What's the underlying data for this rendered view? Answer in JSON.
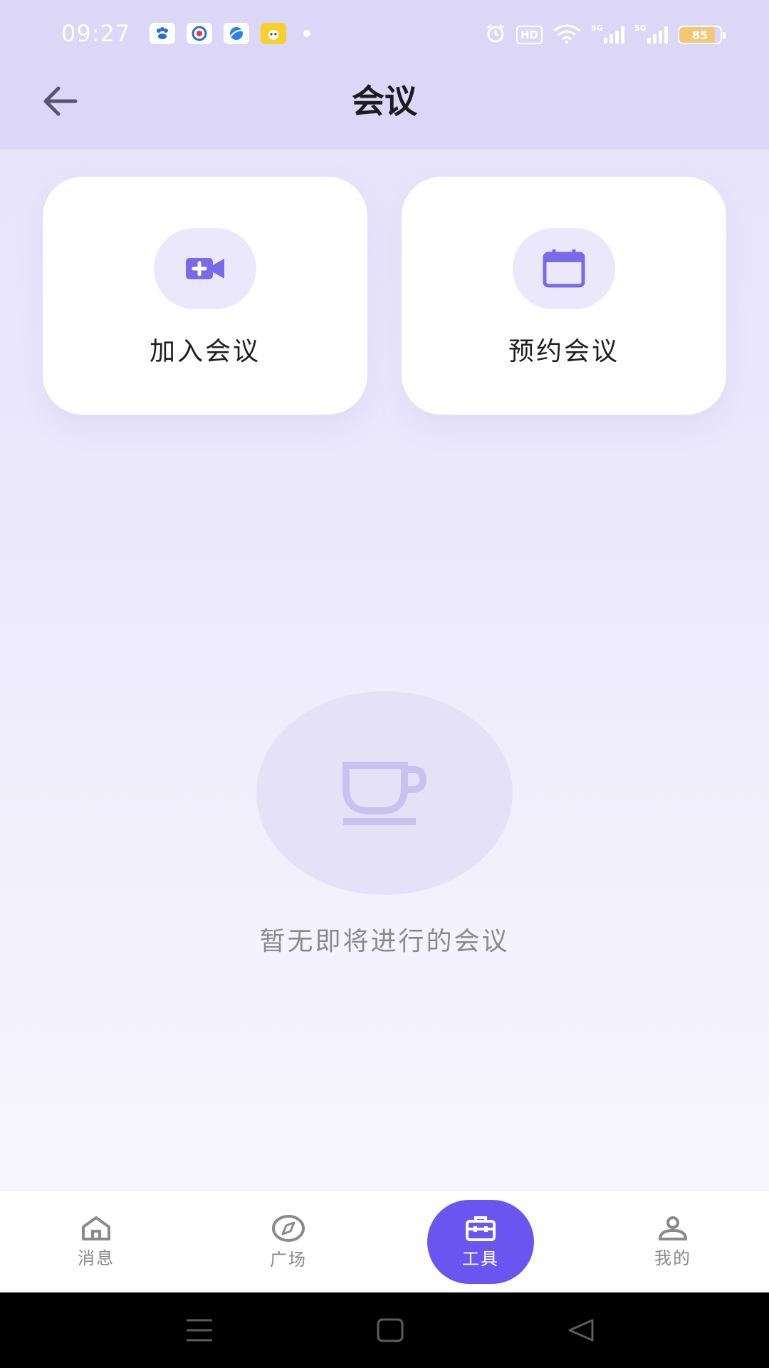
{
  "status_bar": {
    "time": "09:27",
    "hd_label": "HD",
    "network_1": "5G",
    "network_2": "5G",
    "battery": "85",
    "notification_apps": [
      "baidu-app-icon",
      "tencent-news-icon",
      "browser-icon",
      "game-icon"
    ]
  },
  "header": {
    "title": "会议",
    "back_icon": "arrow-left-icon"
  },
  "actions": [
    {
      "label": "加入会议",
      "icon": "video-plus-icon"
    },
    {
      "label": "预约会议",
      "icon": "calendar-icon"
    }
  ],
  "empty_state": {
    "icon": "cup-icon",
    "message": "暂无即将进行的会议"
  },
  "tabs": [
    {
      "label": "消息",
      "icon": "home-icon",
      "active": false
    },
    {
      "label": "广场",
      "icon": "compass-icon",
      "active": false
    },
    {
      "label": "工具",
      "icon": "toolbox-icon",
      "active": true
    },
    {
      "label": "我的",
      "icon": "user-icon",
      "active": false
    }
  ],
  "colors": {
    "accent": "#6b55f0",
    "header_bg": "#dcd7f6",
    "icon_bg": "#ebe8fc",
    "icon_fg": "#7a6ae8"
  }
}
